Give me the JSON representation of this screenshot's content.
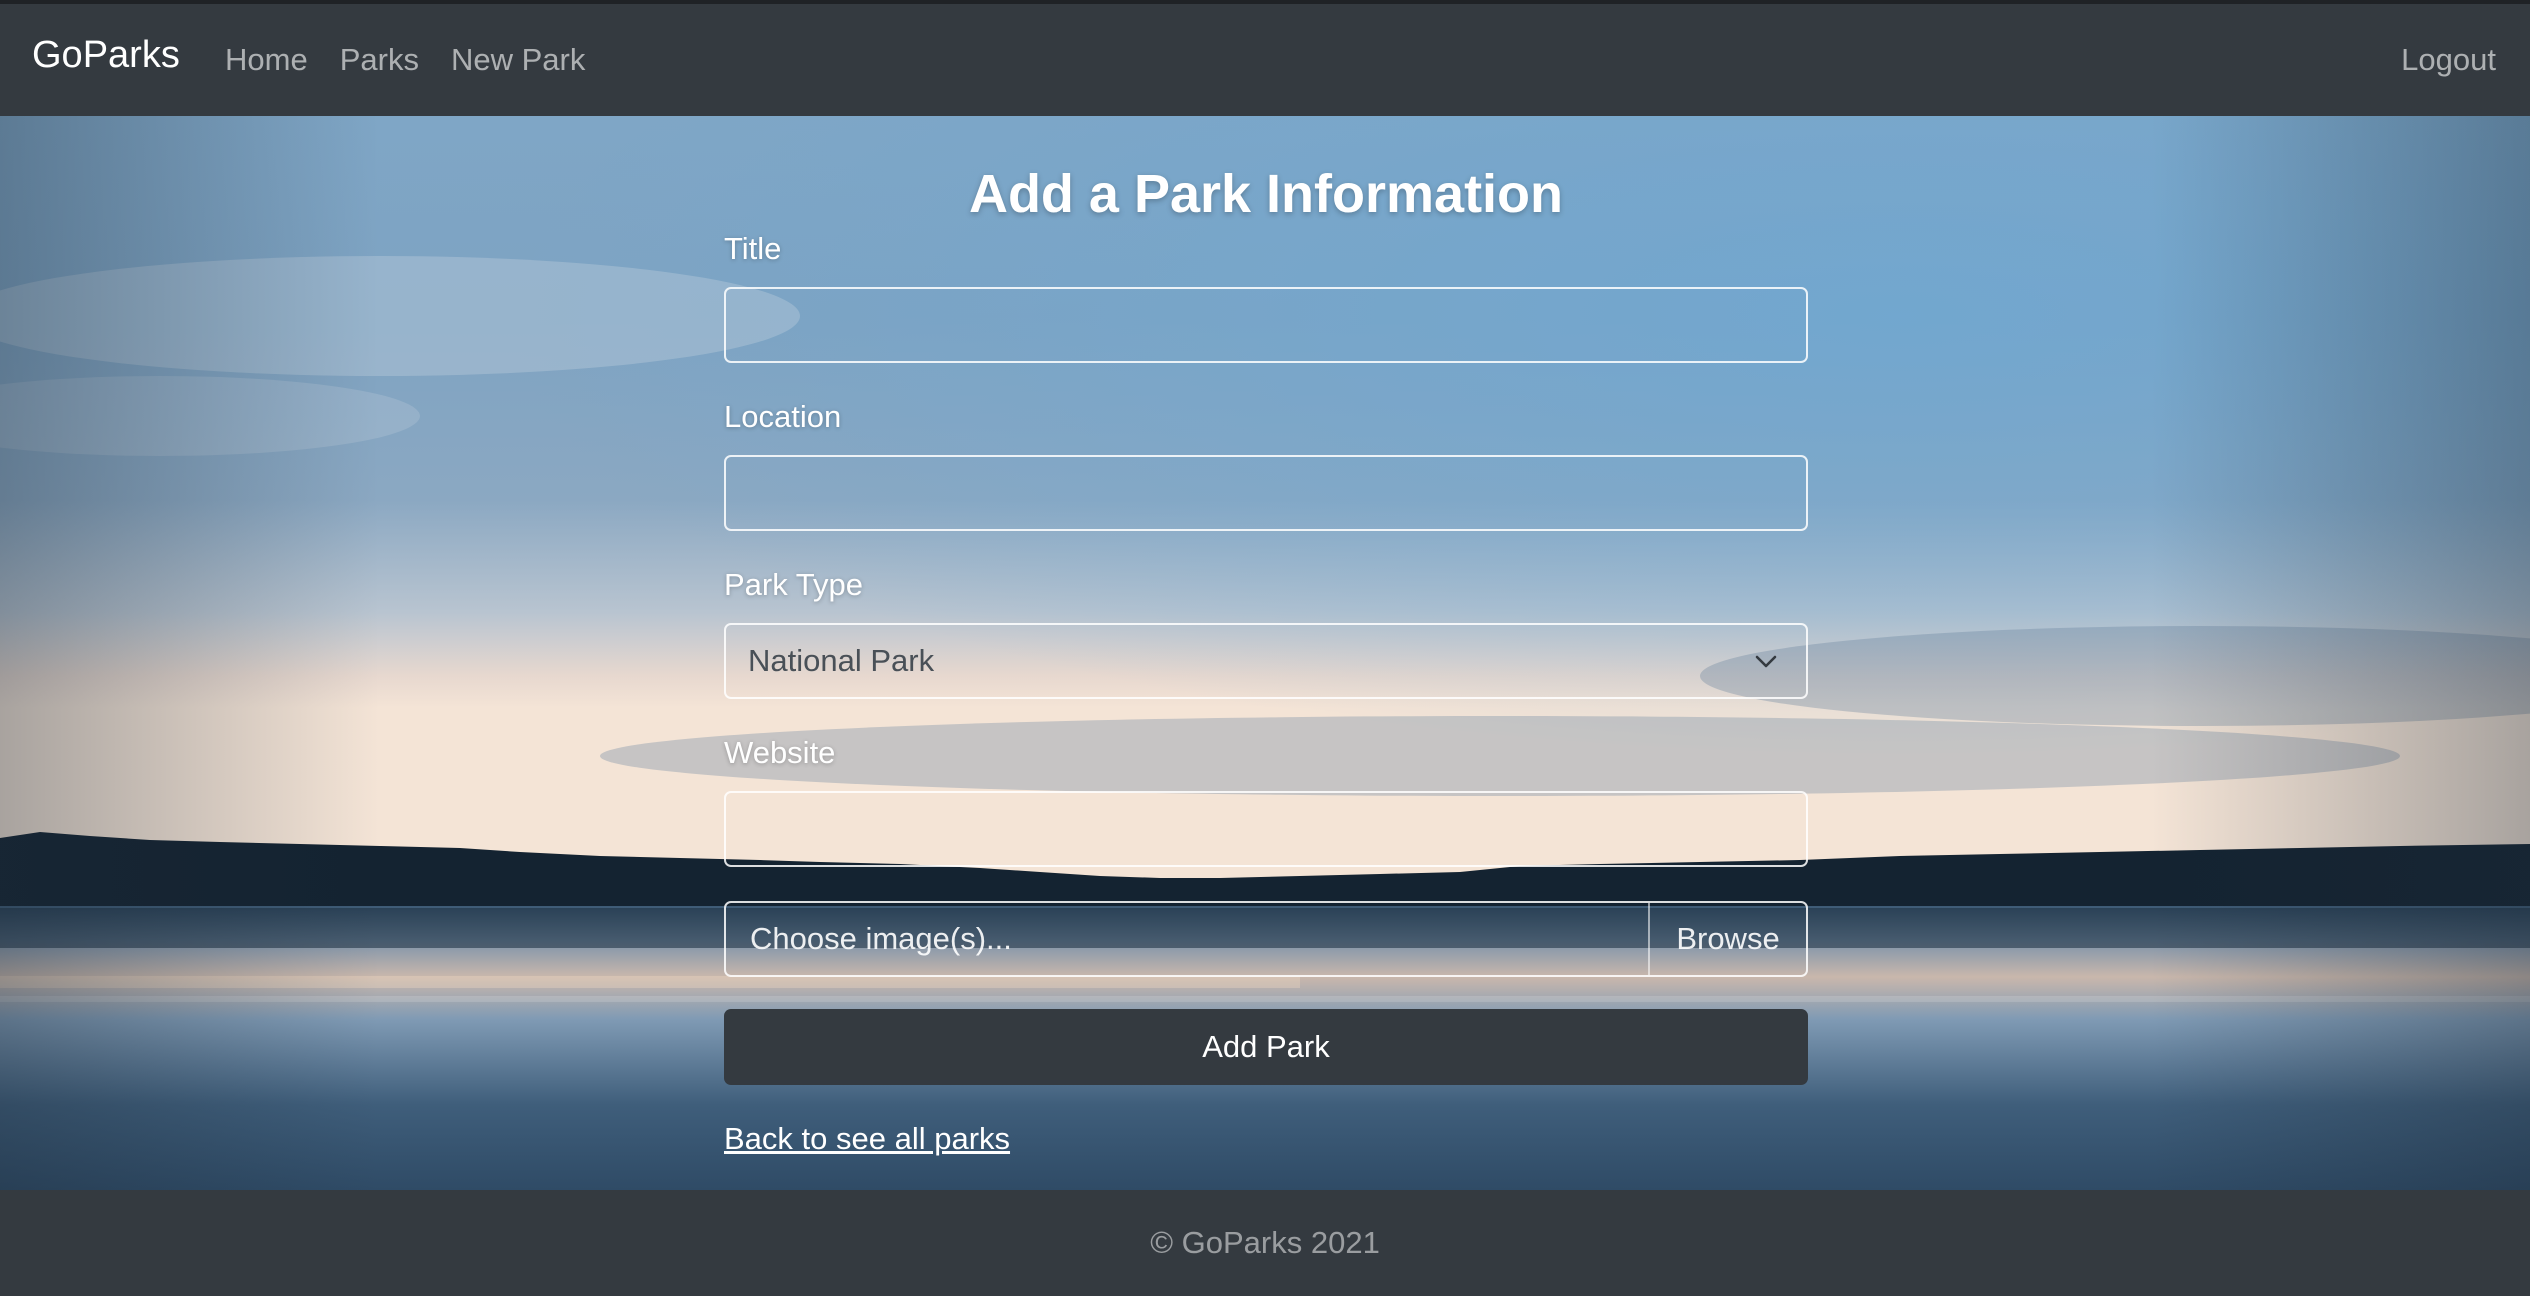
{
  "navbar": {
    "brand": "GoParks",
    "links": [
      {
        "label": "Home"
      },
      {
        "label": "Parks"
      },
      {
        "label": "New Park"
      }
    ],
    "logout": "Logout"
  },
  "form": {
    "heading": "Add a Park Information",
    "title_label": "Title",
    "title_value": "",
    "location_label": "Location",
    "location_value": "",
    "park_type_label": "Park Type",
    "park_type_selected": "National Park",
    "website_label": "Website",
    "website_value": "",
    "file_placeholder": "Choose image(s)...",
    "file_browse": "Browse",
    "submit_label": "Add Park",
    "back_link": "Back to see all parks"
  },
  "footer": {
    "text": "© GoParks 2021"
  },
  "icons": {
    "select_chevron": "chevron-down-icon"
  },
  "colors": {
    "navbar_bg": "#343a40",
    "button_bg": "#343a40",
    "footer_text": "#8e9194"
  }
}
